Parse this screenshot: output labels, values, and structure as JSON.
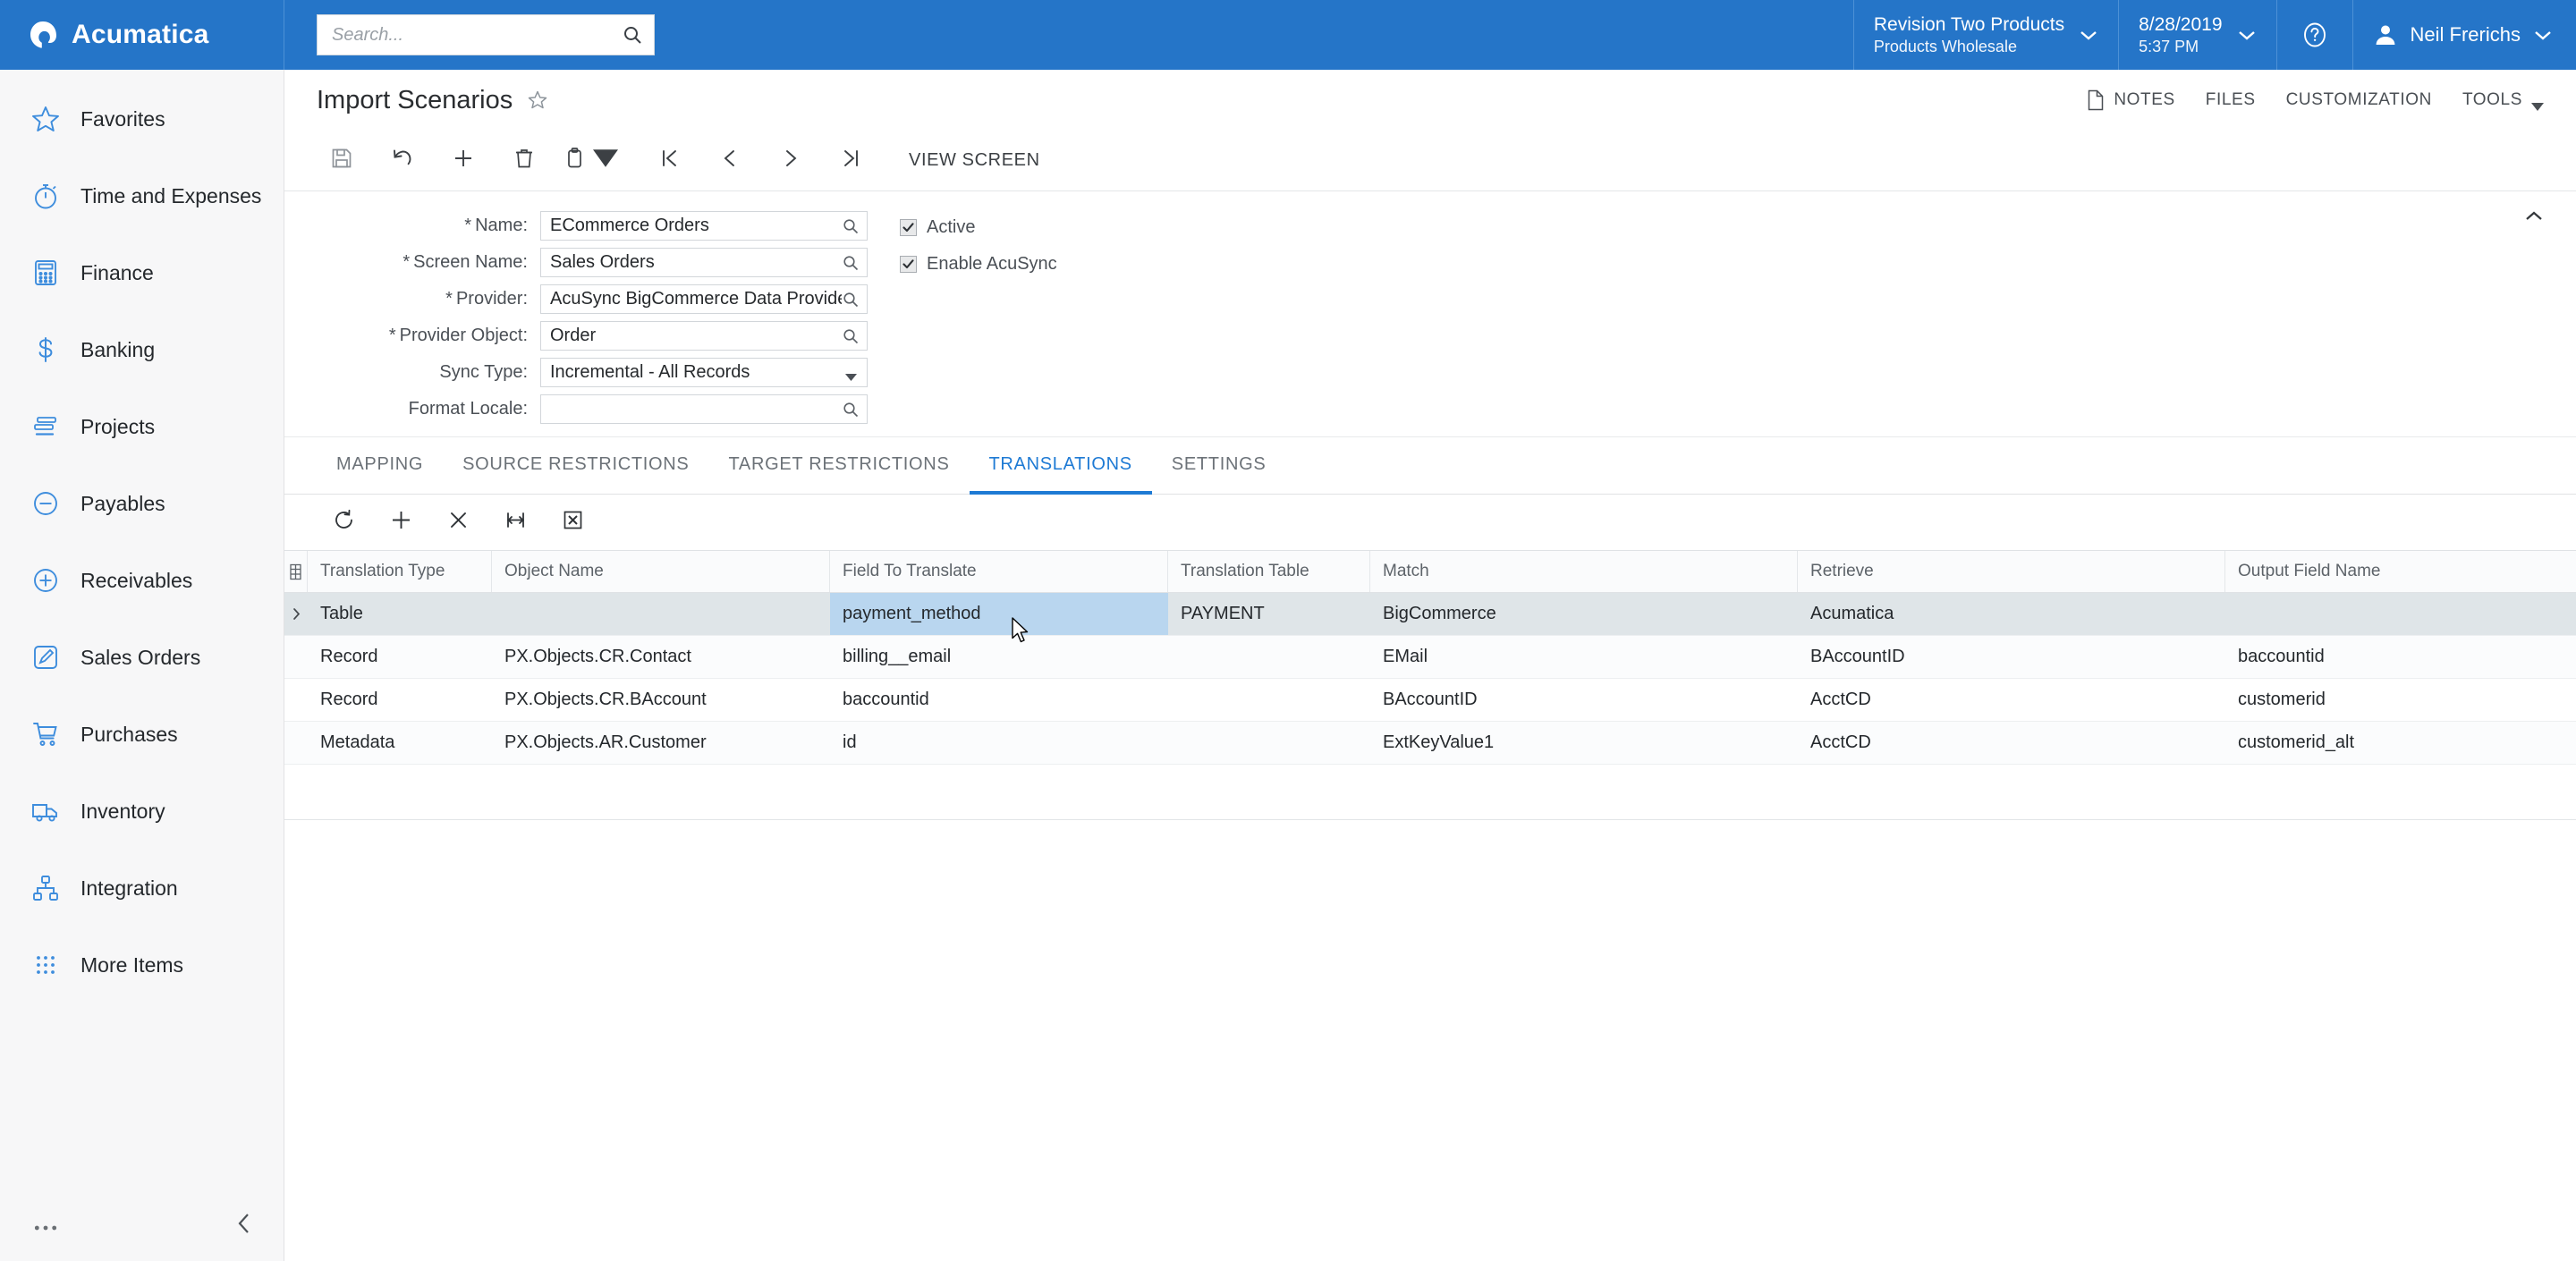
{
  "topbar": {
    "brand": "Acumatica",
    "brand_logo_icon": "acumatica-logo-icon",
    "search_placeholder": "Search...",
    "search_value": "",
    "search_icon": "search-icon",
    "company_line1": "Revision Two Products",
    "company_line2": "Products Wholesale",
    "date": "8/28/2019",
    "time": "5:37 PM",
    "help_icon": "help-circle-icon",
    "avatar_icon": "user-avatar-icon",
    "user_name": "Neil Frerichs",
    "accent_color": "#2575c8"
  },
  "sidebar": {
    "items": [
      {
        "label": "Favorites",
        "icon": "star-icon"
      },
      {
        "label": "Time and Expenses",
        "icon": "stopwatch-icon"
      },
      {
        "label": "Finance",
        "icon": "calculator-icon"
      },
      {
        "label": "Banking",
        "icon": "dollar-sign-icon"
      },
      {
        "label": "Projects",
        "icon": "gantt-bars-icon"
      },
      {
        "label": "Payables",
        "icon": "minus-circle-icon"
      },
      {
        "label": "Receivables",
        "icon": "plus-circle-icon"
      },
      {
        "label": "Sales Orders",
        "icon": "pencil-square-icon"
      },
      {
        "label": "Purchases",
        "icon": "shopping-cart-icon"
      },
      {
        "label": "Inventory",
        "icon": "truck-icon"
      },
      {
        "label": "Integration",
        "icon": "sitemap-icon"
      },
      {
        "label": "More Items",
        "icon": "grid-dots-icon"
      }
    ],
    "more_dots_icon": "ellipsis-icon",
    "collapse_icon": "chevron-left-icon"
  },
  "page": {
    "title": "Import Scenarios",
    "favorite_icon": "star-outline-icon",
    "head_links": [
      {
        "label": "NOTES",
        "icon": "note-page-icon",
        "has_caret": false
      },
      {
        "label": "FILES",
        "icon": "",
        "has_caret": false
      },
      {
        "label": "CUSTOMIZATION",
        "icon": "",
        "has_caret": false
      },
      {
        "label": "TOOLS",
        "icon": "",
        "has_caret": true
      }
    ]
  },
  "toolbar": {
    "buttons": [
      {
        "name": "save-button",
        "icon": "save-disk-icon"
      },
      {
        "name": "undo-button",
        "icon": "undo-arrow-icon"
      },
      {
        "name": "add-new-record-button",
        "icon": "plus-icon"
      },
      {
        "name": "delete-record-button",
        "icon": "trash-icon"
      },
      {
        "name": "copy-paste-button",
        "icon": "clipboard-icon",
        "has_caret": true
      },
      {
        "name": "first-record-button",
        "icon": "first-page-icon"
      },
      {
        "name": "previous-record-button",
        "icon": "chevron-left-icon"
      },
      {
        "name": "next-record-button",
        "icon": "chevron-right-icon"
      },
      {
        "name": "last-record-button",
        "icon": "last-page-icon"
      }
    ],
    "view_screen_label": "VIEW SCREEN"
  },
  "form": {
    "fields": [
      {
        "label": "Name:",
        "required": true,
        "value": "ECommerce Orders",
        "control": "lookup"
      },
      {
        "label": "Screen Name:",
        "required": true,
        "value": "Sales Orders",
        "control": "lookup"
      },
      {
        "label": "Provider:",
        "required": true,
        "value": "AcuSync BigCommerce Data Provider",
        "control": "lookup"
      },
      {
        "label": "Provider Object:",
        "required": true,
        "value": "Order",
        "control": "lookup"
      },
      {
        "label": "Sync Type:",
        "required": false,
        "value": "Incremental - All Records",
        "control": "select"
      },
      {
        "label": "Format Locale:",
        "required": false,
        "value": "",
        "control": "lookup"
      }
    ],
    "checkboxes": [
      {
        "label": "Active",
        "checked": true
      },
      {
        "label": "Enable AcuSync",
        "checked": true
      }
    ],
    "collapse_icon": "chevron-up-icon"
  },
  "tabs": [
    {
      "label": "MAPPING",
      "active": false
    },
    {
      "label": "SOURCE RESTRICTIONS",
      "active": false
    },
    {
      "label": "TARGET RESTRICTIONS",
      "active": false
    },
    {
      "label": "TRANSLATIONS",
      "active": true
    },
    {
      "label": "SETTINGS",
      "active": false
    }
  ],
  "grid_toolbar": {
    "buttons": [
      {
        "name": "refresh-button",
        "icon": "refresh-icon"
      },
      {
        "name": "add-row-button",
        "icon": "plus-icon"
      },
      {
        "name": "delete-row-button",
        "icon": "close-x-icon"
      },
      {
        "name": "fit-columns-button",
        "icon": "fit-width-icon"
      },
      {
        "name": "export-to-excel-button",
        "icon": "excel-icon"
      }
    ]
  },
  "grid": {
    "column_selector_icon": "column-config-icon",
    "columns": [
      "Translation Type",
      "Object Name",
      "Field To Translate",
      "Translation Table",
      "Match",
      "Retrieve",
      "Output Field Name"
    ],
    "rows": [
      {
        "selected": true,
        "expandable": true,
        "selected_cell": "field_to_translate",
        "translation_type": "Table",
        "object_name": "",
        "field_to_translate": "payment_method",
        "translation_table": "PAYMENT",
        "match": "BigCommerce",
        "retrieve": "Acumatica",
        "output_field_name": ""
      },
      {
        "selected": false,
        "expandable": false,
        "translation_type": "Record",
        "object_name": "PX.Objects.CR.Contact",
        "field_to_translate": "billing__email",
        "translation_table": "",
        "match": "EMail",
        "retrieve": "BAccountID",
        "output_field_name": "baccountid"
      },
      {
        "selected": false,
        "expandable": false,
        "translation_type": "Record",
        "object_name": "PX.Objects.CR.BAccount",
        "field_to_translate": "baccountid",
        "translation_table": "",
        "match": "BAccountID",
        "retrieve": "AcctCD",
        "output_field_name": "customerid"
      },
      {
        "selected": false,
        "expandable": false,
        "translation_type": "Metadata",
        "object_name": "PX.Objects.AR.Customer",
        "field_to_translate": "id",
        "translation_table": "",
        "match": "ExtKeyValue1",
        "retrieve": "AcctCD",
        "output_field_name": "customerid_alt"
      }
    ]
  },
  "cursor": {
    "icon": "mouse-pointer-icon"
  }
}
